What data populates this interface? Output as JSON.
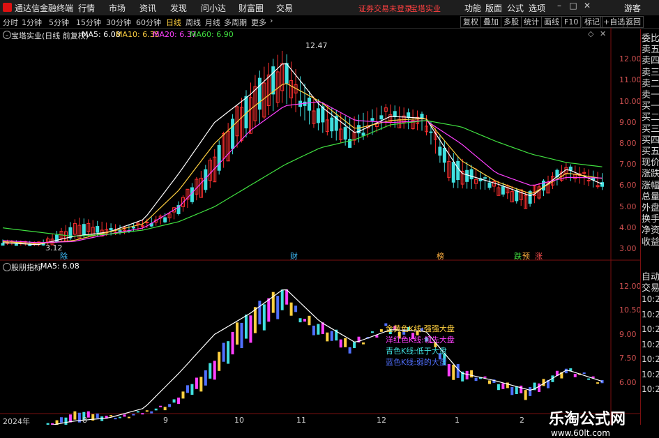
{
  "titlebar": {
    "app_name": "通达信金融终端",
    "menu": [
      "行情",
      "市场",
      "资讯",
      "发现",
      "问小达",
      "财富圈",
      "交易"
    ],
    "notice": "证券交易未登录",
    "stock": "宝塔实业",
    "right": [
      "功能",
      "版面",
      "公式",
      "选项"
    ],
    "guest": "游客"
  },
  "periods": [
    "分时",
    "1分钟",
    "5分钟",
    "15分钟",
    "30分钟",
    "60分钟",
    "日线",
    "周线",
    "月线",
    "多周期",
    "更多"
  ],
  "active_period": "日线",
  "tools": [
    "复权",
    "叠加",
    "多股",
    "统计",
    "画线",
    "F10",
    "标记",
    "+自选",
    "返回"
  ],
  "main_chart": {
    "title": "宝塔实业(日线 前复权)",
    "ma": [
      {
        "label": "MA5: 6.08",
        "color": "#ffffff"
      },
      {
        "label": "MA10: 6.35",
        "color": "#ffd040"
      },
      {
        "label": "MA20: 6.37",
        "color": "#ff40ff"
      },
      {
        "label": "MA60: 6.90",
        "color": "#40e040"
      }
    ],
    "high_label": "12.47",
    "low_label": "3.12",
    "ticks": [
      "12.00",
      "11.00",
      "10.00",
      "9.00",
      "8.00",
      "7.00",
      "6.00",
      "5.00",
      "4.00",
      "3.00"
    ],
    "tags": [
      {
        "t": "除",
        "c": "#40c0ff"
      },
      {
        "t": "财",
        "c": "#40c0ff"
      },
      {
        "t": "榜",
        "c": "#ffb040"
      },
      {
        "t": "跌",
        "c": "#40e040"
      },
      {
        "t": "预",
        "c": "#ffb040"
      },
      {
        "t": "涨",
        "c": "#ff5050"
      }
    ]
  },
  "sub_chart": {
    "title": "股朋指标",
    "ma": "MA5: 6.08",
    "ticks": [
      "12.00",
      "10.50",
      "9.00",
      "7.50",
      "6.00"
    ],
    "legend": [
      {
        "t": "金黄色K线:强强大盘",
        "c": "#ffd040"
      },
      {
        "t": "洋红色K线:领先大盘",
        "c": "#ff40ff"
      },
      {
        "t": "青色K线:低于大盘",
        "c": "#40e0e0"
      },
      {
        "t": "蓝色K线:弱的大盘",
        "c": "#5070ff"
      }
    ]
  },
  "x_axis": [
    "2024年",
    "8",
    "9",
    "10",
    "11",
    "12",
    "1",
    "2"
  ],
  "right_panel": [
    "委比",
    "卖五",
    "卖四",
    "卖三",
    "卖二",
    "卖一",
    "买一",
    "买二",
    "买三",
    "买四",
    "买五",
    "现价",
    "涨跌",
    "涨幅",
    "总量",
    "外盘",
    "换手",
    "净资",
    "收益",
    "自动",
    "交易"
  ],
  "times": [
    "10:29",
    "10:29",
    "10:29",
    "10:29",
    "10:29",
    "10:29",
    "10:29"
  ],
  "watermark": {
    "text": "乐淘公式网",
    "url": "www.60lt.com"
  },
  "chart_data": {
    "type": "candlestick",
    "title": "宝塔实业(日线 前复权)",
    "ylim": [
      2.7,
      12.9
    ],
    "x_months": [
      "2024年",
      "8",
      "9",
      "10",
      "11",
      "12",
      "1",
      "2"
    ],
    "ohlc_samples": [
      {
        "x": 0,
        "o": 3.3,
        "h": 3.45,
        "l": 3.2,
        "c": 3.35
      },
      {
        "x": 8,
        "o": 3.2,
        "h": 3.35,
        "l": 3.12,
        "c": 3.25
      },
      {
        "x": 16,
        "o": 3.6,
        "h": 4.5,
        "l": 3.5,
        "c": 4.2
      },
      {
        "x": 26,
        "o": 3.9,
        "h": 4.1,
        "l": 3.7,
        "c": 3.8
      },
      {
        "x": 36,
        "o": 4.5,
        "h": 4.8,
        "l": 4.3,
        "c": 4.7
      },
      {
        "x": 44,
        "o": 6.0,
        "h": 7.2,
        "l": 5.8,
        "c": 7.0
      },
      {
        "x": 50,
        "o": 8.0,
        "h": 9.8,
        "l": 7.8,
        "c": 9.5
      },
      {
        "x": 54,
        "o": 9.2,
        "h": 11.3,
        "l": 8.8,
        "c": 10.8
      },
      {
        "x": 60,
        "o": 10.5,
        "h": 12.47,
        "l": 10.0,
        "c": 11.8
      },
      {
        "x": 66,
        "o": 9.9,
        "h": 10.3,
        "l": 8.8,
        "c": 9.2
      },
      {
        "x": 74,
        "o": 8.5,
        "h": 9.2,
        "l": 7.8,
        "c": 8.0
      },
      {
        "x": 82,
        "o": 9.2,
        "h": 9.9,
        "l": 8.8,
        "c": 9.5
      },
      {
        "x": 90,
        "o": 8.9,
        "h": 9.5,
        "l": 8.6,
        "c": 9.2
      },
      {
        "x": 96,
        "o": 7.2,
        "h": 7.6,
        "l": 5.9,
        "c": 6.2
      },
      {
        "x": 104,
        "o": 6.0,
        "h": 6.4,
        "l": 5.8,
        "c": 6.2
      },
      {
        "x": 112,
        "o": 5.0,
        "h": 5.7,
        "l": 4.9,
        "c": 5.6
      },
      {
        "x": 120,
        "o": 6.6,
        "h": 7.1,
        "l": 6.3,
        "c": 6.9
      },
      {
        "x": 128,
        "o": 6.2,
        "h": 6.6,
        "l": 5.8,
        "c": 6.0
      }
    ],
    "series": [
      {
        "name": "MA5",
        "color": "#ffffff",
        "values": [
          3.3,
          3.2,
          3.6,
          3.8,
          4.4,
          6.6,
          9.0,
          10.3,
          11.9,
          9.8,
          8.5,
          9.3,
          9.2,
          6.6,
          6.1,
          5.5,
          6.8,
          6.08
        ]
      },
      {
        "name": "MA10",
        "color": "#ffd040",
        "values": [
          3.35,
          3.25,
          3.4,
          3.8,
          4.2,
          5.8,
          8.0,
          9.6,
          10.9,
          10.0,
          8.7,
          9.1,
          9.2,
          7.2,
          6.2,
          5.6,
          6.6,
          6.35
        ]
      },
      {
        "name": "MA20",
        "color": "#ff40ff",
        "values": [
          3.4,
          3.3,
          3.35,
          3.7,
          4.0,
          5.0,
          6.8,
          8.6,
          9.8,
          10.0,
          9.1,
          9.0,
          9.1,
          8.0,
          6.6,
          6.0,
          6.4,
          6.37
        ]
      },
      {
        "name": "MA60",
        "color": "#40e040",
        "values": [
          4.0,
          3.8,
          3.6,
          3.7,
          3.9,
          4.3,
          5.0,
          6.0,
          7.0,
          7.8,
          8.2,
          8.9,
          9.1,
          8.8,
          8.1,
          7.5,
          7.1,
          6.9
        ]
      }
    ]
  }
}
